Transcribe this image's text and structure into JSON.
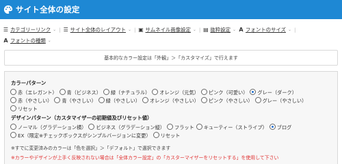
{
  "header": {
    "title": "サイト全体の設定",
    "icon": "palette-icon",
    "bg": "#1e88d4"
  },
  "nav": [
    {
      "name": "category-link",
      "icon": "list-icon",
      "glyph": "☰",
      "label": "カテゴリーリンク"
    },
    {
      "name": "layout",
      "icon": "list-icon",
      "glyph": "☰",
      "label": "サイト全体のレイアウト"
    },
    {
      "name": "thumbnail",
      "icon": "image-icon",
      "glyph": "▣",
      "label": "サムネイル画像設定"
    },
    {
      "name": "indent",
      "icon": "document-icon",
      "glyph": "▤",
      "label": "抜粋設定"
    },
    {
      "name": "font-size",
      "icon": "font-icon",
      "glyph": "A",
      "label": "フォントのサイズ"
    },
    {
      "name": "font-type",
      "icon": "font-icon",
      "glyph": "A",
      "label": "フォントの種類"
    }
  ],
  "info": "基本的なカラー設定は「外観」＞「カスタマイズ」で行えます",
  "color_pattern": {
    "title": "カラーパターン",
    "options": [
      {
        "label": "赤（エレガント）",
        "checked": false
      },
      {
        "label": "青（ビジネス）",
        "checked": false
      },
      {
        "label": "緑（ナチュラル）",
        "checked": false
      },
      {
        "label": "オレンジ（元気）",
        "checked": false
      },
      {
        "label": "ピンク（可愛い）",
        "checked": false
      },
      {
        "label": "グレー（ダーク）",
        "checked": true
      },
      {
        "label": "赤（やさしい）",
        "checked": false
      },
      {
        "label": "青（やさしい）",
        "checked": false
      },
      {
        "label": "緑（やさしい）",
        "checked": false
      },
      {
        "label": "オレンジ（やさしい）",
        "checked": false
      },
      {
        "label": "ピンク（やさしい）",
        "checked": false
      },
      {
        "label": "グレー（やさしい）",
        "checked": false
      },
      {
        "label": "リセット",
        "checked": false
      }
    ]
  },
  "design_pattern": {
    "title": "デザインパターン（カスタマイザーの初期値及びリセット値）",
    "options": [
      {
        "label": "ノーマル（グラデーション横）",
        "checked": false
      },
      {
        "label": "ビジネス（グラデーション縦）",
        "checked": false
      },
      {
        "label": "フラット",
        "checked": false
      },
      {
        "label": "キューティー（ストライプ）",
        "checked": false
      },
      {
        "label": "ブログ",
        "checked": true
      },
      {
        "label": "EX（限定※チェックボックスがシンプルバージョンに変更）",
        "checked": false
      },
      {
        "label": "リセット",
        "checked": false
      }
    ]
  },
  "note": "※すでに変更済みのカラーは「色を選択」＞「デフォルト」で選択できます",
  "warning": "※カラーやデザインが上手く反映されない場合は「全体カラー設定」の「カスターマイザーをリセットする」を使用して下さい"
}
